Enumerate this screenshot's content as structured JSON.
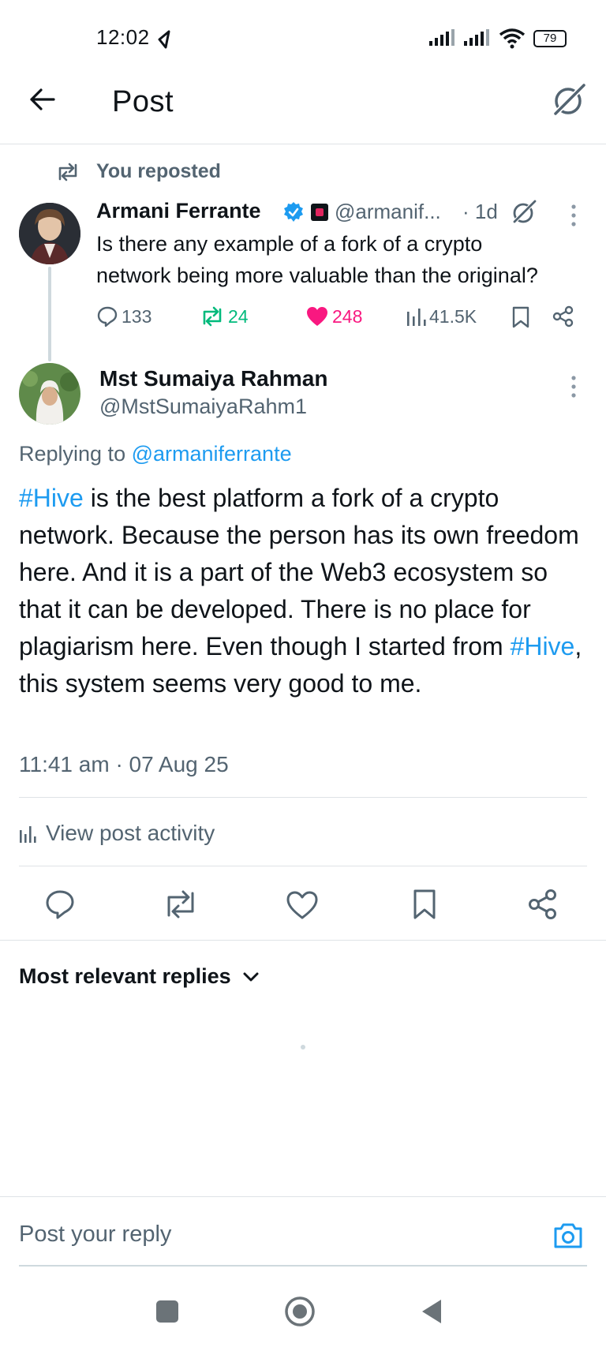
{
  "status_bar": {
    "time": "12:02",
    "battery": "79"
  },
  "header": {
    "title": "Post"
  },
  "repost": {
    "label": "You reposted"
  },
  "original_post": {
    "author_name": "Armani Ferrante",
    "handle": "@armanif...",
    "age": "· 1d",
    "text_line1": "Is there any example of a fork of a crypto",
    "text_line2": "network being more valuable than the original?",
    "replies": "133",
    "reposts": "24",
    "likes": "248",
    "views": "41.5K"
  },
  "reply_post": {
    "author_name": "Mst Sumaiya Rahman",
    "handle": "@MstSumaiyaRahm1",
    "replying_to_prefix": "Replying to ",
    "replying_to_handle": "@armaniferrante",
    "hashtag1": "#Hive",
    "text_part1": " is the best platform a fork of a crypto network. Because the person has its own freedom here. And it is a part of the Web3 ecosystem so that it can be developed. There is no place for plagiarism here. Even though I started from ",
    "hashtag2": "#Hive",
    "text_part2": ", this system seems very good to me.",
    "timestamp": "11:41 am · 07 Aug 25",
    "view_activity": "View post activity"
  },
  "replies_section": {
    "sort_label": "Most relevant replies"
  },
  "reply_bar": {
    "placeholder": "Post your reply"
  },
  "colors": {
    "accent_blue": "#1d9bf0",
    "repost_green": "#00ba7c",
    "like_pink": "#f91880",
    "muted_gray": "#536471"
  }
}
